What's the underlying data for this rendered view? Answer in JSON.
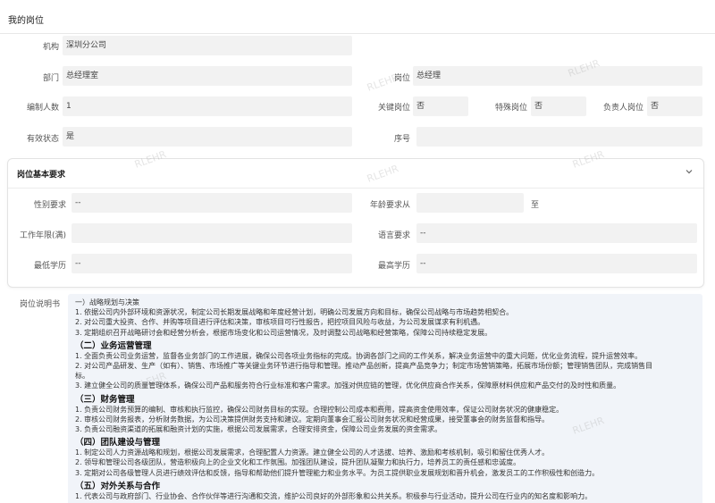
{
  "page": {
    "title": "我的岗位"
  },
  "fields": {
    "org": {
      "label": "机构",
      "value": "深圳分公司"
    },
    "dept": {
      "label": "部门",
      "value": "总经理室"
    },
    "position": {
      "label": "岗位",
      "value": "总经理"
    },
    "headcount": {
      "label": "编制人数",
      "value": "1"
    },
    "key_position": {
      "label": "关键岗位",
      "value": "否"
    },
    "special_position": {
      "label": "特殊岗位",
      "value": "否"
    },
    "responsible_position": {
      "label": "负责人岗位",
      "value": "否"
    },
    "valid_status": {
      "label": "有效状态",
      "value": "是"
    },
    "serial": {
      "label": "序号",
      "value": ""
    }
  },
  "requirements": {
    "title": "岗位基本要求",
    "gender": {
      "label": "性别要求",
      "value": "--"
    },
    "age": {
      "label": "年龄要求从",
      "from": "",
      "to_label": "至"
    },
    "work_years": {
      "label": "工作年限(满)",
      "value": ""
    },
    "language": {
      "label": "语言要求",
      "value": "--"
    },
    "min_edu": {
      "label": "最低学历",
      "value": "--"
    },
    "max_edu": {
      "label": "最高学历",
      "value": "--"
    }
  },
  "description": {
    "label": "岗位说明书",
    "lines": [
      {
        "text": "一）战略规划与决策",
        "head": false
      },
      {
        "text": "1. 依据公司内外部环境和资源状况，制定公司长期发展战略和年度经营计划，明确公司发展方向和目标，确保公司战略与市场趋势相契合。",
        "head": false
      },
      {
        "text": "2. 对公司重大投资、合作、并购等项目进行评估和决策，审核项目可行性报告，把控项目风险与收益，为公司发展谋求有利机遇。",
        "head": false
      },
      {
        "text": "3. 定期组织召开战略研讨会和经营分析会，根据市场变化和公司运营情况，及时调整公司战略和经营策略，保障公司持续稳定发展。",
        "head": false
      },
      {
        "text": "（二）业务运营管理",
        "head": true
      },
      {
        "text": "1. 全面负责公司业务运营，监督各业务部门的工作进展，确保公司各项业务指标的完成。协调各部门之间的工作关系，解决业务运营中的重大问题，优化业务流程，提升运营效率。",
        "head": false
      },
      {
        "text": "2. 对公司产品研发、生产（如有）、销售、市场推广等关键业务环节进行指导和管理。推动产品创新，提高产品竞争力；制定市场营销策略，拓展市场份额；管理销售团队，完成销售目",
        "head": false
      },
      {
        "text": "标。",
        "head": false
      },
      {
        "text": "3. 建立健全公司的质量管理体系，确保公司产品和服务符合行业标准和客户需求。加强对供应链的管理，优化供应商合作关系，保障原材料供应和产品交付的及时性和质量。",
        "head": false
      },
      {
        "text": "（三）财务管理",
        "head": true
      },
      {
        "text": "1. 负责公司财务预算的编制、审核和执行监控，确保公司财务目标的实现。合理控制公司成本和费用，提高资金使用效率，保证公司财务状况的健康稳定。",
        "head": false
      },
      {
        "text": "2. 审核公司财务报表，分析财务数据，为公司决策提供财务支持和建议。定期向董事会汇报公司财务状况和经营成果，接受董事会的财务监督和指导。",
        "head": false
      },
      {
        "text": "3. 负责公司融资渠道的拓展和融资计划的实施，根据公司发展需求，合理安排资金，保障公司业务发展的资金需求。",
        "head": false
      },
      {
        "text": "（四）团队建设与管理",
        "head": true
      },
      {
        "text": "1. 制定公司人力资源战略和规划，根据公司发展需求，合理配置人力资源。建立健全公司的人才选拔、培养、激励和考核机制，吸引和留住优秀人才。",
        "head": false
      },
      {
        "text": "2. 领导和管理公司各级团队，营造积极向上的企业文化和工作氛围。加强团队建设，提升团队凝聚力和执行力，培养员工的责任感和忠诚度。",
        "head": false
      },
      {
        "text": "3. 定期对公司各级管理人员进行绩效评估和反馈，指导和帮助他们提升管理能力和业务水平。为员工提供职业发展规划和晋升机会，激发员工的工作积极性和创造力。",
        "head": false
      },
      {
        "text": "（五）对外关系与合作",
        "head": true
      },
      {
        "text": "1. 代表公司与政府部门、行业协会、合作伙伴等进行沟通和交流，维护公司良好的外部形象和公共关系。积极参与行业活动，提升公司在行业内的知名度和影响力。",
        "head": false
      }
    ]
  },
  "watermark": "RLEHR"
}
